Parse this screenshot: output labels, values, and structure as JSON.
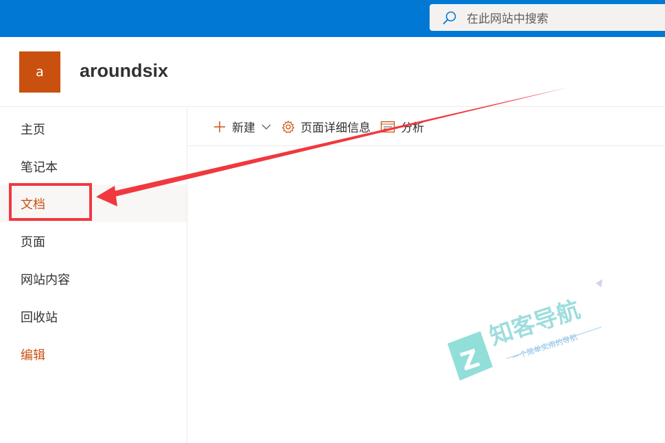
{
  "topbar": {
    "search_placeholder": "在此网站中搜索",
    "search_icon": "search-icon"
  },
  "site": {
    "logo_letter": "a",
    "title": "aroundsix",
    "brand_color": "#ca5010"
  },
  "leftnav": {
    "items": [
      {
        "label": "主页"
      },
      {
        "label": "笔记本"
      },
      {
        "label": "文档",
        "selected": true
      },
      {
        "label": "页面"
      },
      {
        "label": "网站内容"
      },
      {
        "label": "回收站"
      },
      {
        "label": "编辑"
      }
    ]
  },
  "commandbar": {
    "new_label": "新建",
    "page_details_label": "页面详细信息",
    "analytics_label": "分析"
  },
  "annotation": {
    "arrow_color": "#f0383e"
  },
  "watermark": {
    "brand": "知客导航",
    "slogan": "一个简单实用的导航"
  }
}
